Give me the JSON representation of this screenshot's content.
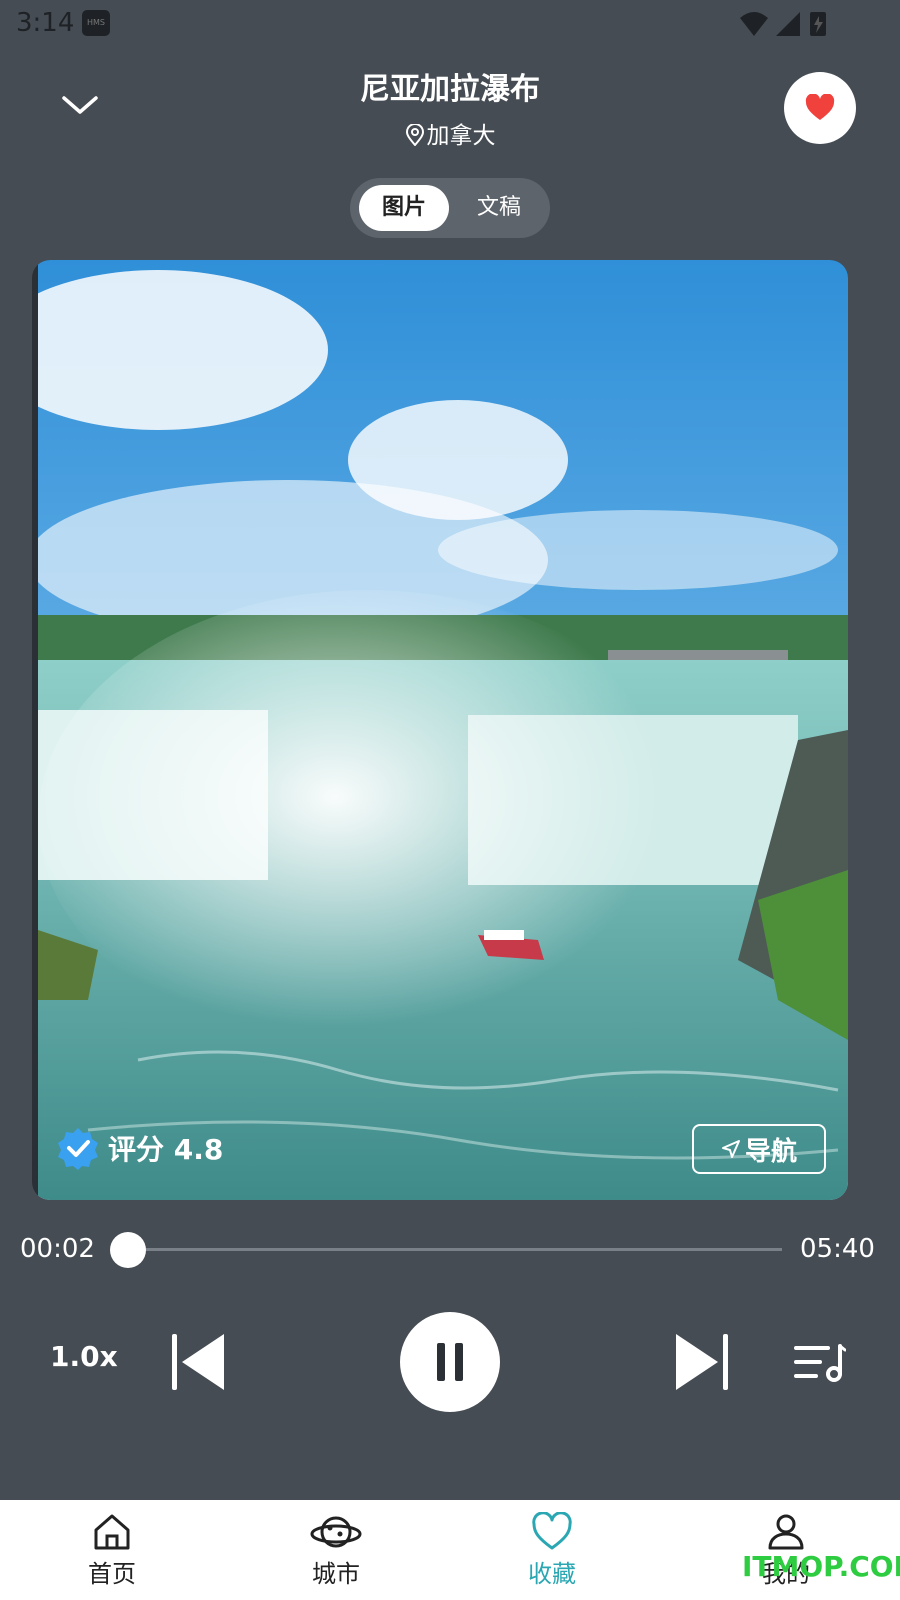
{
  "status_bar": {
    "time": "3:14",
    "hms_badge": "HMS"
  },
  "header": {
    "title": "尼亚加拉瀑布",
    "location": "加拿大",
    "favorite_icon": "heart-icon",
    "collapse_icon": "chevron-down-icon"
  },
  "view_toggle": {
    "options": [
      "图片",
      "文稿"
    ],
    "selected": "图片"
  },
  "card": {
    "rating_label": "评分 4.8",
    "nav_label": "导航"
  },
  "player": {
    "current_time": "00:02",
    "total_time": "05:40",
    "progress": 0.006,
    "speed": "1.0x",
    "state": "playing"
  },
  "tabs": [
    {
      "label": "首页",
      "icon": "home-icon"
    },
    {
      "label": "城市",
      "icon": "planet-icon"
    },
    {
      "label": "收藏",
      "icon": "heart-outline-icon"
    },
    {
      "label": "我的",
      "icon": "user-icon"
    }
  ],
  "active_tab": "收藏",
  "watermark": "ITMOP.COM",
  "colors": {
    "background": "#454c53",
    "accent": "#2aa7b2",
    "favorite": "#f0413c",
    "verified": "#3aa0f0"
  }
}
